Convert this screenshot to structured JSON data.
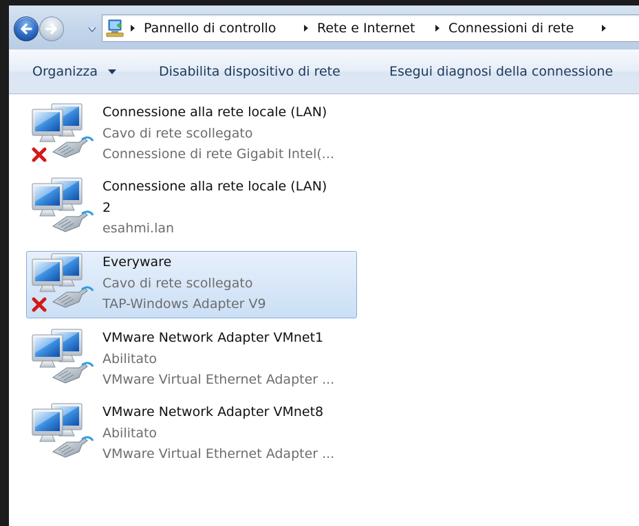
{
  "breadcrumb": {
    "items": [
      "Pannello di controllo",
      "Rete e Internet",
      "Connessioni di rete"
    ]
  },
  "toolbar": {
    "organize_label": "Organizza",
    "disable_label": "Disabilita dispositivo di rete",
    "diagnose_label": "Esegui diagnosi della connessione"
  },
  "connections": [
    {
      "name": "Connessione alla rete locale (LAN)",
      "status": "Cavo di rete scollegato",
      "device": "Connessione di rete Gigabit Intel(...",
      "disconnected": true,
      "selected": false
    },
    {
      "name": "Connessione alla rete locale (LAN)",
      "name_line2": "2",
      "status": "esahmi.lan",
      "disconnected": false,
      "selected": false
    },
    {
      "name": "Everyware",
      "status": "Cavo di rete scollegato",
      "device": "TAP-Windows Adapter V9",
      "disconnected": true,
      "selected": true
    },
    {
      "name": "VMware Network Adapter VMnet1",
      "status": "Abilitato",
      "device": "VMware Virtual Ethernet Adapter ...",
      "disconnected": false,
      "selected": false
    },
    {
      "name": "VMware Network Adapter VMnet8",
      "status": "Abilitato",
      "device": "VMware Virtual Ethernet Adapter ...",
      "disconnected": false,
      "selected": false
    }
  ],
  "colors": {
    "accent_blue": "#2b6bc4",
    "selection_border": "#84acdd",
    "error_red": "#d21a1a",
    "command_text": "#1e395b"
  }
}
